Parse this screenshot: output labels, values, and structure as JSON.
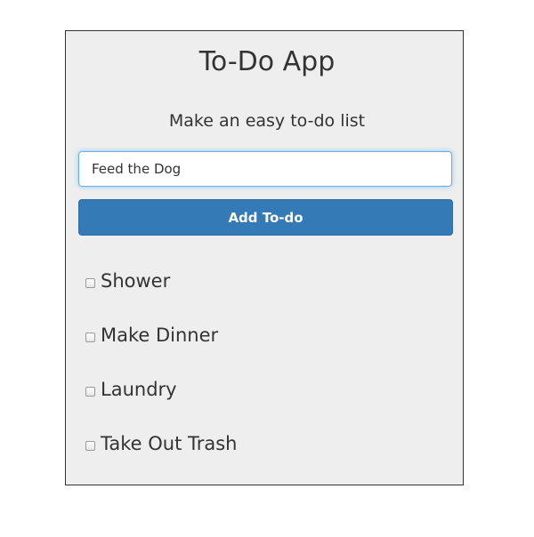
{
  "app": {
    "title": "To-Do App",
    "subtitle": "Make an easy to-do list"
  },
  "form": {
    "input_value": "Feed the Dog",
    "add_button_label": "Add To-do"
  },
  "todos": [
    {
      "label": "Shower",
      "checked": false
    },
    {
      "label": "Make Dinner",
      "checked": false
    },
    {
      "label": "Laundry",
      "checked": false
    },
    {
      "label": "Take Out Trash",
      "checked": false
    }
  ],
  "colors": {
    "panel_background": "#eeeeee",
    "primary_button": "#337ab7",
    "input_focus_border": "#66afe9",
    "text": "#333333"
  }
}
